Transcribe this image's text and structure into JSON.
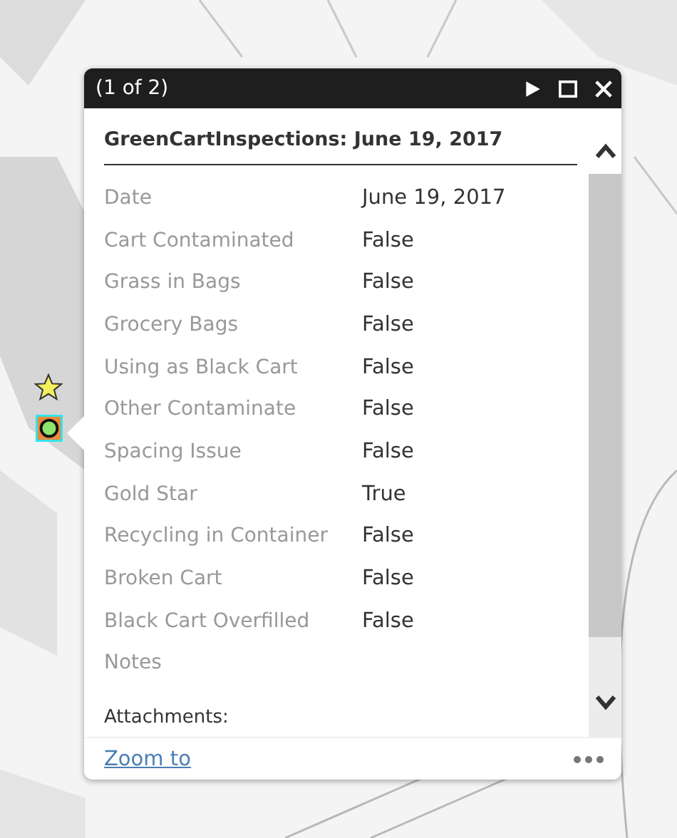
{
  "popup": {
    "pager": "(1 of 2)",
    "title": "GreenCartInspections: June 19, 2017",
    "fields": [
      {
        "label": "Date",
        "value": "June 19, 2017"
      },
      {
        "label": "Cart Contaminated",
        "value": "False"
      },
      {
        "label": "Grass in Bags",
        "value": "False"
      },
      {
        "label": "Grocery Bags",
        "value": "False"
      },
      {
        "label": "Using as Black Cart",
        "value": "False"
      },
      {
        "label": "Other Contaminate",
        "value": "False"
      },
      {
        "label": "Spacing Issue",
        "value": "False"
      },
      {
        "label": "Gold Star",
        "value": "True"
      },
      {
        "label": "Recycling in Container",
        "value": "False"
      },
      {
        "label": "Broken Cart",
        "value": "False"
      },
      {
        "label": "Black Cart Overfilled",
        "value": "False"
      },
      {
        "label": "Notes"
      }
    ],
    "attachments_label": "Attachments:",
    "zoom_link": "Zoom to"
  }
}
